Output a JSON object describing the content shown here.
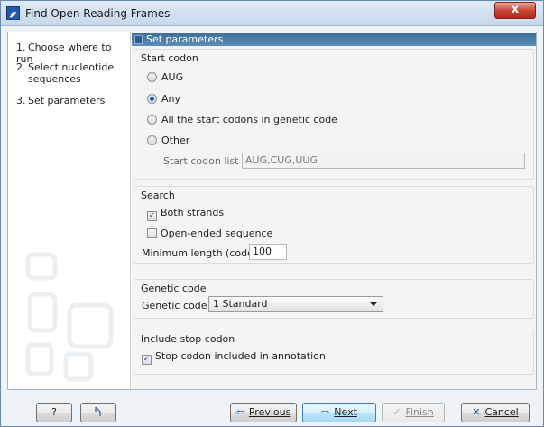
{
  "window": {
    "title": "Find Open Reading Frames",
    "close": "x",
    "app_icon": "𝓰"
  },
  "steps": [
    {
      "num": "1.",
      "label": "Choose where to run"
    },
    {
      "num": "2.",
      "label": "Select nucleotide",
      "label2": "sequences"
    },
    {
      "num": "3.",
      "label": "Set parameters"
    }
  ],
  "panel": {
    "header": "Set parameters",
    "start_codon": {
      "title": "Start codon",
      "options": [
        "AUG",
        "Any",
        "All the start codons in genetic code",
        "Other"
      ],
      "selected": "Any",
      "list_label": "Start codon list",
      "list_value": "AUG,CUG,UUG"
    },
    "search": {
      "title": "Search",
      "both_strands": "Both strands",
      "both_strands_checked": true,
      "open_ended": "Open-ended sequence",
      "open_ended_checked": false,
      "min_length_label": "Minimum length (codons)",
      "min_length_value": "100"
    },
    "genetic_code": {
      "title": "Genetic code",
      "label": "Genetic code",
      "value": "1 Standard"
    },
    "stop_codon": {
      "title": "Include stop codon",
      "label": "Stop codon included in annotation",
      "checked": true
    }
  },
  "footer": {
    "help": "?",
    "reset_icon": "reset-icon",
    "previous": "Previous",
    "next": "Next",
    "finish": "Finish",
    "cancel": "Cancel"
  },
  "colors": {
    "header_blue": "#3d6f9c",
    "radio_dot": "#1f5fae",
    "close_red": "#c9473a"
  }
}
